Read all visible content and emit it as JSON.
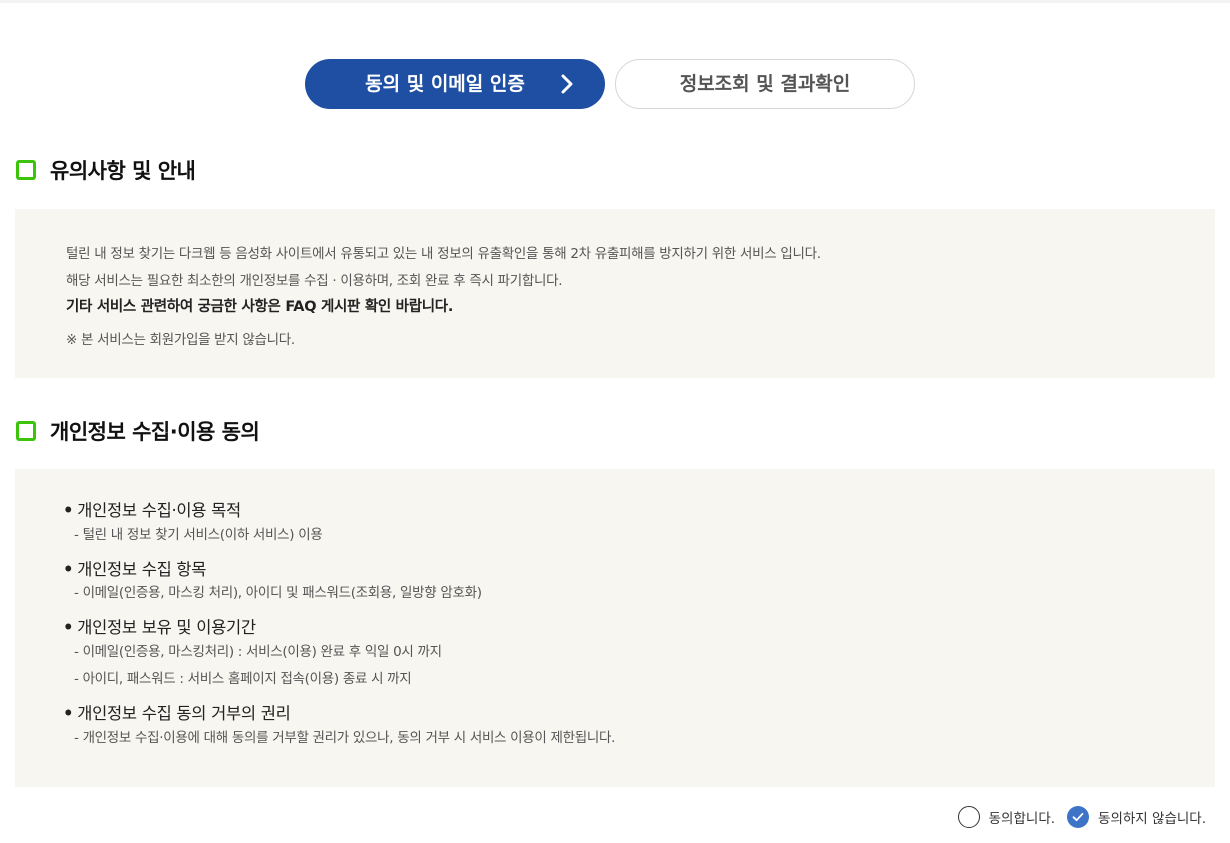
{
  "steps": [
    {
      "label": "동의 및 이메일 인증",
      "active": true
    },
    {
      "label": "정보조회 및 결과확인",
      "active": false
    }
  ],
  "notice": {
    "title": "유의사항 및 안내",
    "lines": [
      "털린 내 정보 찾기는 다크웹 등 음성화 사이트에서 유통되고 있는 내 정보의 유출확인을 통해 2차 유출피해를 방지하기 위한 서비스 입니다.",
      "해당 서비스는 필요한 최소한의 개인정보를 수집 · 이용하며, 조회 완료 후 즉시 파기합니다.",
      "기타 서비스 관련하여 궁금한 사항은 FAQ 게시판 확인 바랍니다.",
      "※ 본 서비스는 회원가입을 받지 않습니다."
    ]
  },
  "privacy": {
    "title": "개인정보 수집·이용 동의",
    "items": [
      {
        "title": "개인정보 수집·이용 목적",
        "details": [
          "- 털린 내 정보 찾기 서비스(이하 서비스) 이용"
        ]
      },
      {
        "title": "개인정보 수집 항목",
        "details": [
          "- 이메일(인증용, 마스킹 처리), 아이디 및 패스워드(조회용, 일방향 암호화)"
        ]
      },
      {
        "title": "개인정보 보유 및 이용기간",
        "details": [
          "- 이메일(인증용, 마스킹처리) : 서비스(이용) 완료 후 익일 0시 까지",
          "- 아이디, 패스워드 : 서비스 홈페이지 접속(이용) 종료 시 까지"
        ]
      },
      {
        "title": "개인정보 수집 동의 거부의 권리",
        "details": [
          "- 개인정보 수집·이용에 대해 동의를 거부할 권리가 있으나, 동의 거부 시 서비스 이용이 제한됩니다."
        ]
      }
    ]
  },
  "consent": {
    "agree_label": "동의합니다.",
    "disagree_label": "동의하지 않습니다.",
    "selected": "disagree"
  },
  "colors": {
    "primary": "#1f4fa2",
    "accent_green": "#3cc40a",
    "box_bg": "#f8f6f1",
    "radio_checked": "#3d74c8"
  },
  "icons": {
    "step_arrow": "chevron-right-icon",
    "section_marker": "green-square-icon",
    "checked": "check-icon"
  }
}
